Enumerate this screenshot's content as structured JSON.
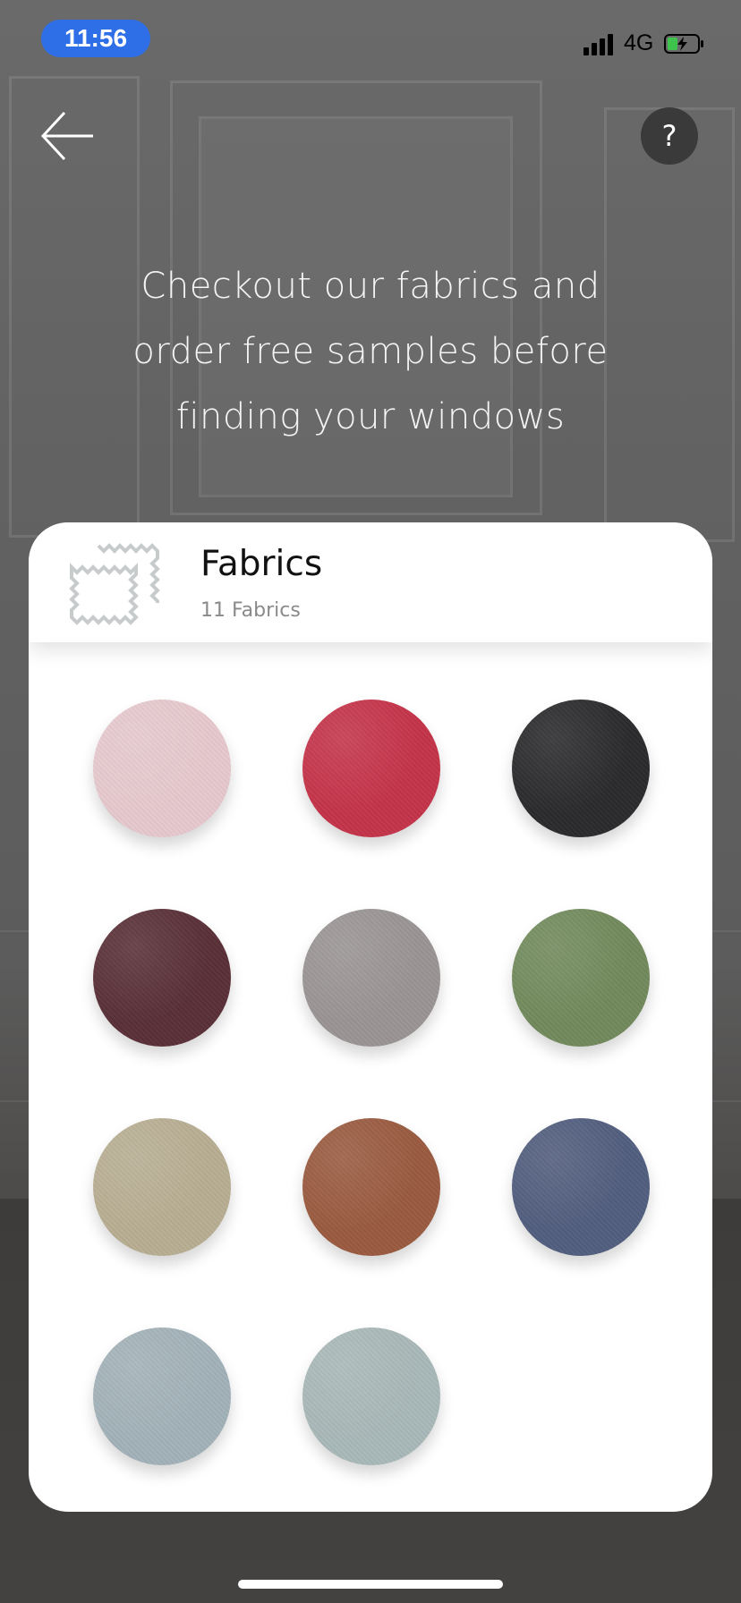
{
  "status_bar": {
    "time": "11:56",
    "network": "4G",
    "time_pill_color": "#2e6ee6",
    "battery_state": "charging"
  },
  "nav": {
    "back_icon": "arrow-left-icon",
    "help_label": "?"
  },
  "headline": {
    "lines": [
      "Checkout our fabrics and",
      "order free samples before",
      "finding your windows"
    ]
  },
  "card": {
    "icon": "fabric-swatch-icon",
    "title": "Fabrics",
    "subtitle": "11 Fabrics"
  },
  "swatches": [
    {
      "name": "pink",
      "color": "#e6c9ce"
    },
    {
      "name": "red",
      "color": "#c5344a"
    },
    {
      "name": "black",
      "color": "#2b2b2d"
    },
    {
      "name": "plum",
      "color": "#5a3038"
    },
    {
      "name": "grey",
      "color": "#9a9594"
    },
    {
      "name": "sage-green",
      "color": "#728a5c"
    },
    {
      "name": "beige",
      "color": "#b8ae93"
    },
    {
      "name": "rust",
      "color": "#9a5b40"
    },
    {
      "name": "slate-blue",
      "color": "#525e7e"
    },
    {
      "name": "light-blue",
      "color": "#a3b2b9"
    },
    {
      "name": "mist",
      "color": "#a9b8b8"
    }
  ]
}
